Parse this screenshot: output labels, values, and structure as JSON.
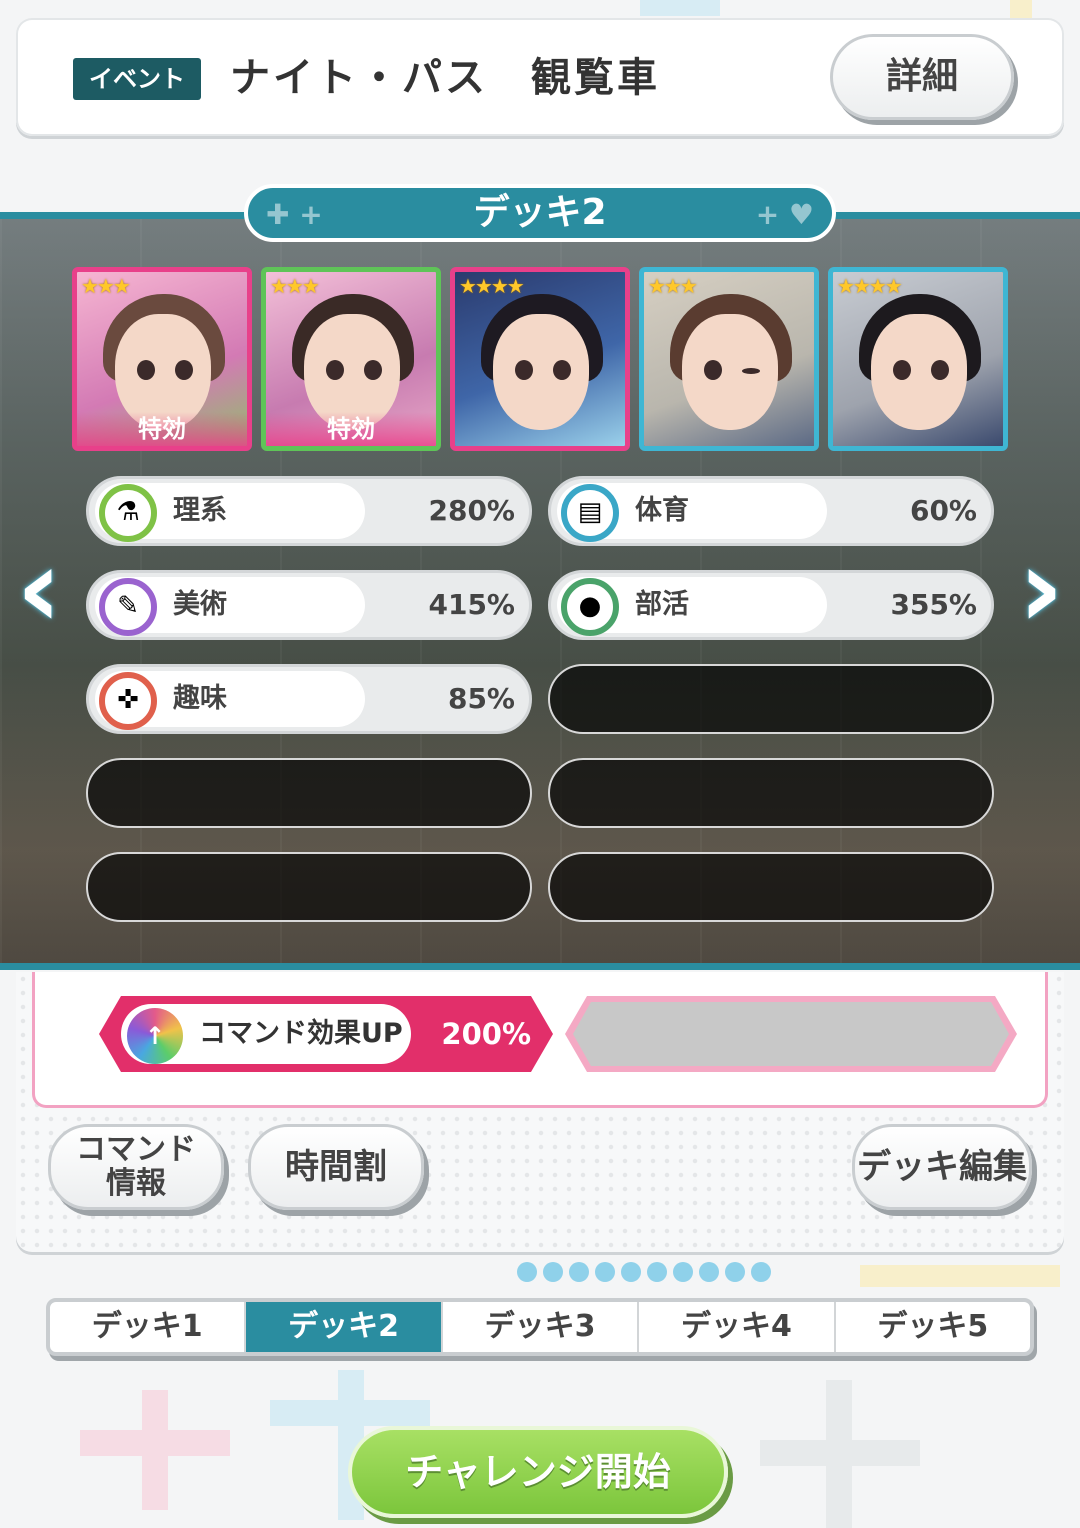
{
  "header": {
    "badge": "イベント",
    "title": "ナイト・パス　観覧車",
    "detail_button": "詳細"
  },
  "deck": {
    "title": "デッキ2",
    "cards": [
      {
        "stars": "★★★",
        "frame": "pink",
        "tag": "特効"
      },
      {
        "stars": "★★★",
        "frame": "green",
        "tag": "特効"
      },
      {
        "stars": "★★★★",
        "frame": "pink",
        "tag": ""
      },
      {
        "stars": "★★★",
        "frame": "blue",
        "tag": ""
      },
      {
        "stars": "★★★★",
        "frame": "blue",
        "tag": ""
      }
    ],
    "stats": [
      {
        "label": "理系",
        "value": "280%",
        "icon": "flask-icon",
        "color": "#7fc246"
      },
      {
        "label": "体育",
        "value": "60%",
        "icon": "dumbbell-icon",
        "color": "#3aa7c7"
      },
      {
        "label": "美術",
        "value": "415%",
        "icon": "paintbrush-icon",
        "color": "#9a63cf"
      },
      {
        "label": "部活",
        "value": "355%",
        "icon": "ball-icon",
        "color": "#4aa36a"
      },
      {
        "label": "趣味",
        "value": "85%",
        "icon": "gamepad-icon",
        "color": "#e0604c"
      }
    ]
  },
  "command": {
    "label": "コマンド効果UP",
    "value": "200%"
  },
  "buttons": {
    "command_info_line1": "コマンド",
    "command_info_line2": "情報",
    "timetable": "時間割",
    "deck_edit": "デッキ編集"
  },
  "tabs": [
    "デッキ1",
    "デッキ2",
    "デッキ3",
    "デッキ4",
    "デッキ5"
  ],
  "active_tab": "デッキ2",
  "challenge_button": "チャレンジ開始",
  "colors": {
    "teal": "#2a8da0",
    "pink": "#e22f6a",
    "green": "#7cc63c"
  }
}
